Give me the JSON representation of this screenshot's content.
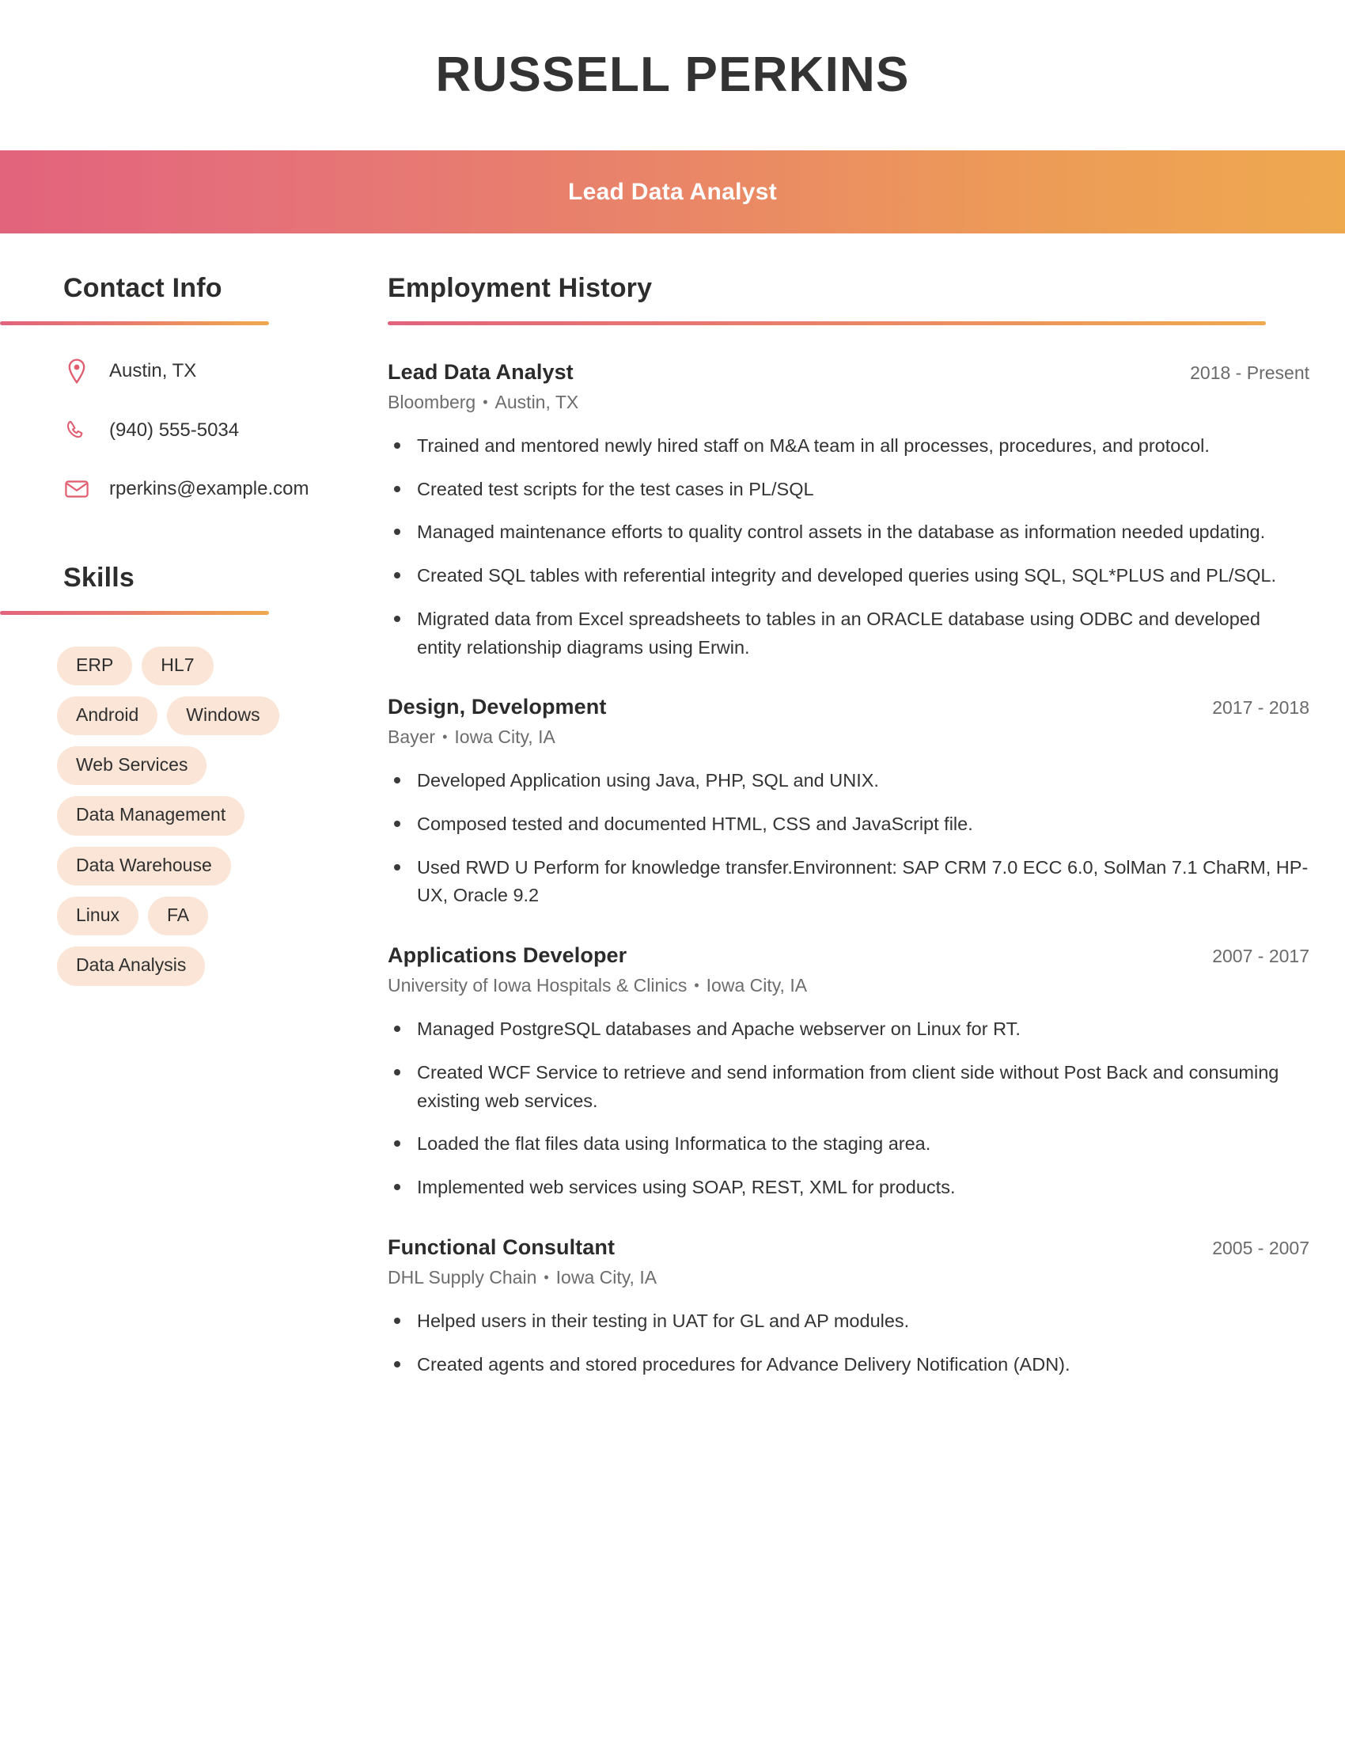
{
  "header": {
    "full_name": "RUSSELL PERKINS",
    "job_title": "Lead Data Analyst",
    "band_gradient_start": "#e2637c",
    "band_gradient_end": "#eea94f"
  },
  "theme": {
    "accent_pink": "#e2637c",
    "accent_orange": "#eea94f",
    "icon_color": "#e05c6e",
    "tag_background": "#fae5d6",
    "text_primary": "#333333",
    "text_muted": "#6d6d6d"
  },
  "sidebar": {
    "contact": {
      "heading": "Contact Info",
      "items": [
        {
          "icon": "location-pin-icon",
          "value": "Austin, TX"
        },
        {
          "icon": "phone-icon",
          "value": "(940) 555-5034"
        },
        {
          "icon": "envelope-icon",
          "value": "rperkins@example.com"
        }
      ]
    },
    "skills": {
      "heading": "Skills",
      "tags": [
        "ERP",
        "HL7",
        "Android",
        "Windows",
        "Web Services",
        "Data Management",
        "Data Warehouse",
        "Linux",
        "FA",
        "Data Analysis"
      ]
    }
  },
  "main": {
    "employment": {
      "heading": "Employment History",
      "separator": "•",
      "jobs": [
        {
          "position": "Lead Data Analyst",
          "dates": "2018 - Present",
          "company": "Bloomberg",
          "location": "Austin, TX",
          "bullets": [
            "Trained and mentored newly hired staff on M&A team in all processes, procedures, and protocol.",
            "Created test scripts for the test cases in PL/SQL",
            "Managed maintenance efforts to quality control assets in the database as information needed updating.",
            "Created SQL tables with referential integrity and developed queries using SQL, SQL*PLUS and PL/SQL.",
            "Migrated data from Excel spreadsheets to tables in an ORACLE database using ODBC and developed entity relationship diagrams using Erwin."
          ]
        },
        {
          "position": "Design, Development",
          "dates": "2017 - 2018",
          "company": "Bayer",
          "location": "Iowa City, IA",
          "bullets": [
            "Developed Application using Java, PHP, SQL and UNIX.",
            "Composed tested and documented HTML, CSS and JavaScript file.",
            "Used RWD U Perform for knowledge transfer.Environnent: SAP CRM 7.0 ECC 6.0, SolMan 7.1 ChaRM, HP-UX, Oracle 9.2"
          ]
        },
        {
          "position": "Applications Developer",
          "dates": "2007 - 2017",
          "company": "University of Iowa Hospitals & Clinics",
          "location": "Iowa City, IA",
          "bullets": [
            "Managed PostgreSQL databases and Apache webserver on Linux for RT.",
            "Created WCF Service to retrieve and send information from client side without Post Back and consuming existing web services.",
            "Loaded the flat files data using Informatica to the staging area.",
            "Implemented web services using SOAP, REST, XML for products."
          ]
        },
        {
          "position": "Functional Consultant",
          "dates": "2005 - 2007",
          "company": "DHL Supply Chain",
          "location": "Iowa City, IA",
          "bullets": [
            "Helped users in their testing in UAT for GL and AP modules.",
            "Created agents and stored procedures for Advance Delivery Notification (ADN)."
          ]
        }
      ]
    }
  }
}
